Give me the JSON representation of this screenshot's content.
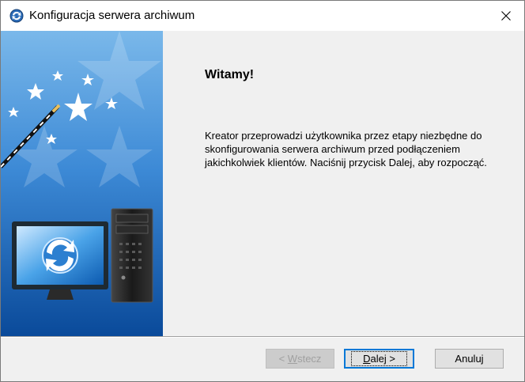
{
  "window": {
    "title": "Konfiguracja serwera archiwum",
    "icon": "archive-server-icon"
  },
  "content": {
    "heading": "Witamy!",
    "description": "Kreator przeprowadzi użytkownika przez etapy niezbędne do skonfigurowania serwera archiwum przed podłączeniem jakichkolwiek klientów. Naciśnij przycisk Dalej, aby rozpocząć."
  },
  "buttons": {
    "back": {
      "prefix": "< ",
      "mnemonic": "W",
      "rest": "stecz",
      "enabled": false
    },
    "next": {
      "mnemonic": "D",
      "rest": "alej >"
    },
    "cancel": "Anuluj"
  },
  "colors": {
    "banner_top": "#7ab8ea",
    "banner_bottom": "#0a4a9a",
    "focus_border": "#0078d7"
  }
}
